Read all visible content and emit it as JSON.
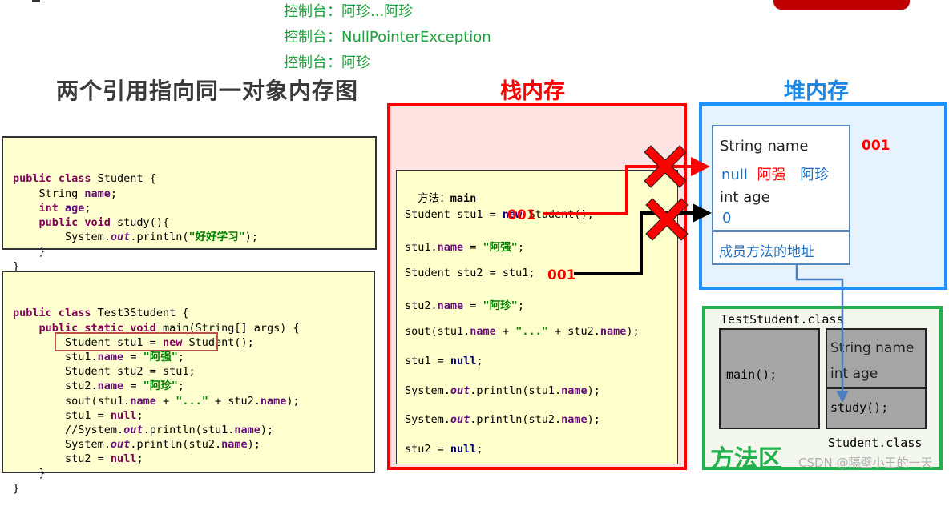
{
  "console_output": [
    "控制台：阿珍...阿珍",
    "控制台：NullPointerException",
    "控制台：阿珍"
  ],
  "main_title": "两个引用指向同一对象内存图",
  "code_student": {
    "lines": [
      [
        {
          "t": "public class ",
          "c": "kw"
        },
        {
          "t": "Student {",
          "c": ""
        }
      ],
      [
        {
          "t": "    String ",
          "c": ""
        },
        {
          "t": "name",
          "c": "fieldp"
        },
        {
          "t": ";",
          "c": ""
        }
      ],
      [
        {
          "t": "    int ",
          "c": "kw"
        },
        {
          "t": "age",
          "c": "fieldp"
        },
        {
          "t": ";",
          "c": ""
        }
      ],
      [
        {
          "t": "    public void ",
          "c": "kw"
        },
        {
          "t": "study(){",
          "c": ""
        }
      ],
      [
        {
          "t": "        System.",
          "c": ""
        },
        {
          "t": "out",
          "c": "it"
        },
        {
          "t": ".println(",
          "c": ""
        },
        {
          "t": "\"好好学习\"",
          "c": "str"
        },
        {
          "t": ");",
          "c": ""
        }
      ],
      [
        {
          "t": "    }",
          "c": ""
        }
      ],
      [
        {
          "t": "}",
          "c": ""
        }
      ]
    ]
  },
  "code_test": {
    "lines": [
      [
        {
          "t": "public class ",
          "c": "kw"
        },
        {
          "t": "Test3Student {",
          "c": ""
        }
      ],
      [
        {
          "t": "    public static void ",
          "c": "kw"
        },
        {
          "t": "main(String[] args) {",
          "c": ""
        }
      ],
      [
        {
          "t": "        Student stu1 = ",
          "c": ""
        },
        {
          "t": "new ",
          "c": "kw"
        },
        {
          "t": "Student();",
          "c": ""
        }
      ],
      [
        {
          "t": "        stu1.",
          "c": ""
        },
        {
          "t": "name",
          "c": "fieldp"
        },
        {
          "t": " = ",
          "c": ""
        },
        {
          "t": "\"阿强\"",
          "c": "str"
        },
        {
          "t": ";",
          "c": ""
        }
      ],
      [
        {
          "t": "        Student stu2 = stu1;",
          "c": ""
        }
      ],
      [
        {
          "t": "        stu2.",
          "c": ""
        },
        {
          "t": "name",
          "c": "fieldp"
        },
        {
          "t": " = ",
          "c": ""
        },
        {
          "t": "\"阿珍\"",
          "c": "str"
        },
        {
          "t": ";",
          "c": ""
        }
      ],
      [
        {
          "t": "        sout(stu1.",
          "c": ""
        },
        {
          "t": "name",
          "c": "fieldp"
        },
        {
          "t": " + ",
          "c": ""
        },
        {
          "t": "\"...\"",
          "c": "str"
        },
        {
          "t": " + stu2.",
          "c": ""
        },
        {
          "t": "name",
          "c": "fieldp"
        },
        {
          "t": ");",
          "c": ""
        }
      ],
      [
        {
          "t": "        stu1 = ",
          "c": ""
        },
        {
          "t": "null",
          "c": "kw"
        },
        {
          "t": ";",
          "c": ""
        }
      ],
      [
        {
          "t": "        //System.",
          "c": ""
        },
        {
          "t": "out",
          "c": "it"
        },
        {
          "t": ".println(stu1.",
          "c": ""
        },
        {
          "t": "name",
          "c": "fieldp"
        },
        {
          "t": ");",
          "c": ""
        }
      ],
      [
        {
          "t": "        System.",
          "c": ""
        },
        {
          "t": "out",
          "c": "it"
        },
        {
          "t": ".println(stu2.",
          "c": ""
        },
        {
          "t": "name",
          "c": "fieldp"
        },
        {
          "t": ");",
          "c": ""
        }
      ],
      [
        {
          "t": "        stu2 = ",
          "c": ""
        },
        {
          "t": "null",
          "c": "kw"
        },
        {
          "t": ";",
          "c": ""
        }
      ],
      [
        {
          "t": "    }",
          "c": ""
        }
      ],
      [
        {
          "t": "}",
          "c": ""
        }
      ]
    ],
    "highlighted_line": "Student stu2 = stu1;"
  },
  "stack": {
    "title": "栈内存",
    "frame_label": "方法：",
    "frame_method": "main",
    "lines": [
      [
        {
          "t": "Student stu1 = ",
          "c": ""
        },
        {
          "t": "new",
          "c": "kwb"
        },
        {
          "t": " Student();",
          "c": ""
        }
      ],
      [
        {
          "t": "stu1.",
          "c": ""
        },
        {
          "t": "name",
          "c": "fieldp"
        },
        {
          "t": " = ",
          "c": ""
        },
        {
          "t": "\"阿强\"",
          "c": "str"
        },
        {
          "t": ";",
          "c": ""
        }
      ],
      [
        {
          "t": "Student stu2 = stu1;",
          "c": ""
        }
      ],
      [
        {
          "t": "stu2.",
          "c": ""
        },
        {
          "t": "name",
          "c": "fieldp"
        },
        {
          "t": " = ",
          "c": ""
        },
        {
          "t": "\"阿珍\"",
          "c": "str"
        },
        {
          "t": ";",
          "c": ""
        }
      ],
      [
        {
          "t": "sout(stu1.",
          "c": ""
        },
        {
          "t": "name",
          "c": "fieldp"
        },
        {
          "t": " + ",
          "c": ""
        },
        {
          "t": "\"...\"",
          "c": "str"
        },
        {
          "t": " + stu2.",
          "c": ""
        },
        {
          "t": "name",
          "c": "fieldp"
        },
        {
          "t": ");",
          "c": ""
        }
      ],
      [
        {
          "t": "stu1 = ",
          "c": ""
        },
        {
          "t": "null",
          "c": "kwb"
        },
        {
          "t": ";",
          "c": ""
        }
      ],
      [
        {
          "t": "System.",
          "c": ""
        },
        {
          "t": "out",
          "c": "it"
        },
        {
          "t": ".println(stu1.",
          "c": ""
        },
        {
          "t": "name",
          "c": "fieldp"
        },
        {
          "t": ");",
          "c": ""
        }
      ],
      [
        {
          "t": "System.",
          "c": ""
        },
        {
          "t": "out",
          "c": "it"
        },
        {
          "t": ".println(stu2.",
          "c": ""
        },
        {
          "t": "name",
          "c": "fieldp"
        },
        {
          "t": ");",
          "c": ""
        }
      ],
      [
        {
          "t": "stu2 = ",
          "c": ""
        },
        {
          "t": "null",
          "c": "kwb"
        },
        {
          "t": ";",
          "c": ""
        }
      ]
    ],
    "stu1_address": "001",
    "stu2_address": "001"
  },
  "heap": {
    "title": "堆内存",
    "object_address": "001",
    "field_name_label": "String name",
    "name_values": [
      {
        "text": "null",
        "color": "#1f6fbf"
      },
      {
        "text": "阿强",
        "color": "#ff0000"
      },
      {
        "text": "阿珍",
        "color": "#1f6fbf"
      }
    ],
    "field_age_label": "int age",
    "age_value": "0",
    "method_address_label": "成员方法的地址"
  },
  "method_area": {
    "title": "方法区",
    "test_class_label": "TestStudent.class",
    "test_method": "main();",
    "student_fields": [
      "String name",
      "int age"
    ],
    "student_method": "study();",
    "student_class_label": "Student.class"
  },
  "watermark": "CSDN @隔壁小王的一天",
  "colors": {
    "stack": "#ff0000",
    "heap": "#1e90ff",
    "method_area": "#22b14c",
    "console": "#1aa33a"
  }
}
